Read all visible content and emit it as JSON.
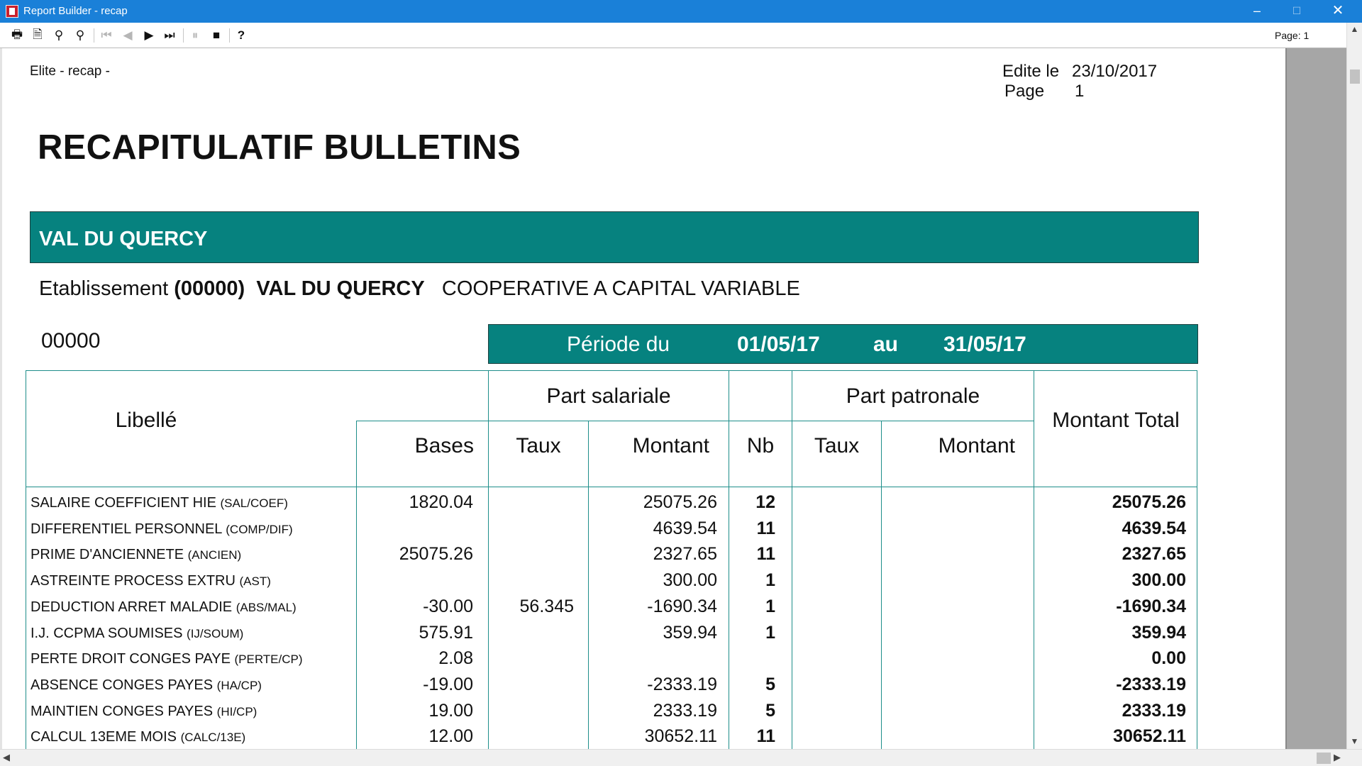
{
  "window": {
    "title": "Report Builder - recap",
    "controls": {
      "minimize": "–",
      "maximize": "☐",
      "close": "✕"
    }
  },
  "toolbar": {
    "buttons": [
      {
        "name": "print-icon",
        "glyph": "🖶",
        "enabled": true
      },
      {
        "name": "page-setup-icon",
        "glyph": "🗎",
        "enabled": true
      },
      {
        "name": "zoom-in-icon",
        "glyph": "⚲",
        "enabled": true
      },
      {
        "name": "zoom-out-icon",
        "glyph": "⚲",
        "enabled": true
      },
      {
        "name": "first-page-icon",
        "glyph": "⏮",
        "enabled": false
      },
      {
        "name": "previous-page-icon",
        "glyph": "◀",
        "enabled": false
      },
      {
        "name": "next-page-icon",
        "glyph": "▶",
        "enabled": true
      },
      {
        "name": "last-page-icon",
        "glyph": "⏭",
        "enabled": true
      },
      {
        "name": "pause-icon",
        "glyph": "⏸",
        "enabled": false
      },
      {
        "name": "stop-icon",
        "glyph": "■",
        "enabled": true
      },
      {
        "name": "help-icon",
        "glyph": "?",
        "enabled": true
      }
    ],
    "page_indicator": "Page: 1"
  },
  "report": {
    "header_left": "Elite - recap -",
    "edit_label": "Edite le",
    "edit_date": "23/10/2017",
    "page_label": "Page",
    "page_number": "1",
    "title": "RECAPITULATIF BULLETINS",
    "company_banner": "VAL DU QUERCY",
    "etablissement": {
      "label": "Etablissement",
      "code": "(00000)",
      "name": "VAL DU QUERCY",
      "description": "COOPERATIVE A CAPITAL VARIABLE"
    },
    "code_number": "00000",
    "period": {
      "label": "Période du",
      "start": "01/05/17",
      "to_label": "au",
      "end": "31/05/17"
    },
    "colors": {
      "teal": "#06827f",
      "border": "#1e8e8a"
    }
  },
  "table": {
    "headers": {
      "libelle": "Libellé",
      "part_salariale": "Part salariale",
      "part_patronale": "Part patronale",
      "bases": "Bases",
      "taux_sal": "Taux",
      "montant_sal": "Montant",
      "nb": "Nb",
      "taux_pat": "Taux",
      "montant_pat": "Montant",
      "montant_total": "Montant Total"
    },
    "rows": [
      {
        "label": "SALAIRE COEFFICIENT HIE",
        "code": "(SAL/COEF)",
        "bases": "1820.04",
        "taux": "",
        "montant": "25075.26",
        "nb": "12",
        "taux_pat": "",
        "montant_pat": "",
        "total": "25075.26"
      },
      {
        "label": "DIFFERENTIEL PERSONNEL",
        "code": "(COMP/DIF)",
        "bases": "",
        "taux": "",
        "montant": "4639.54",
        "nb": "11",
        "taux_pat": "",
        "montant_pat": "",
        "total": "4639.54"
      },
      {
        "label": "PRIME D'ANCIENNETE",
        "code": "(ANCIEN)",
        "bases": "25075.26",
        "taux": "",
        "montant": "2327.65",
        "nb": "11",
        "taux_pat": "",
        "montant_pat": "",
        "total": "2327.65"
      },
      {
        "label": "ASTREINTE PROCESS EXTRU",
        "code": "(AST)",
        "bases": "",
        "taux": "",
        "montant": "300.00",
        "nb": "1",
        "taux_pat": "",
        "montant_pat": "",
        "total": "300.00"
      },
      {
        "label": "DEDUCTION ARRET MALADIE",
        "code": "(ABS/MAL)",
        "bases": "-30.00",
        "taux": "56.345",
        "montant": "-1690.34",
        "nb": "1",
        "taux_pat": "",
        "montant_pat": "",
        "total": "-1690.34"
      },
      {
        "label": "I.J. CCPMA SOUMISES",
        "code": "(IJ/SOUM)",
        "bases": "575.91",
        "taux": "",
        "montant": "359.94",
        "nb": "1",
        "taux_pat": "",
        "montant_pat": "",
        "total": "359.94"
      },
      {
        "label": "PERTE DROIT CONGES PAYE",
        "code": "(PERTE/CP)",
        "bases": "2.08",
        "taux": "",
        "montant": "",
        "nb": "",
        "taux_pat": "",
        "montant_pat": "",
        "total": "0.00"
      },
      {
        "label": "ABSENCE CONGES PAYES",
        "code": "(HA/CP)",
        "bases": "-19.00",
        "taux": "",
        "montant": "-2333.19",
        "nb": "5",
        "taux_pat": "",
        "montant_pat": "",
        "total": "-2333.19"
      },
      {
        "label": "MAINTIEN CONGES PAYES",
        "code": "(HI/CP)",
        "bases": "19.00",
        "taux": "",
        "montant": "2333.19",
        "nb": "5",
        "taux_pat": "",
        "montant_pat": "",
        "total": "2333.19"
      },
      {
        "label": "CALCUL 13EME MOIS",
        "code": "(CALC/13E)",
        "bases": "12.00",
        "taux": "",
        "montant": "30652.11",
        "nb": "11",
        "taux_pat": "",
        "montant_pat": "",
        "total": "30652.11"
      }
    ]
  },
  "scrollbars": {
    "up": "▲",
    "down": "▼",
    "left": "◀",
    "right": "▶"
  }
}
